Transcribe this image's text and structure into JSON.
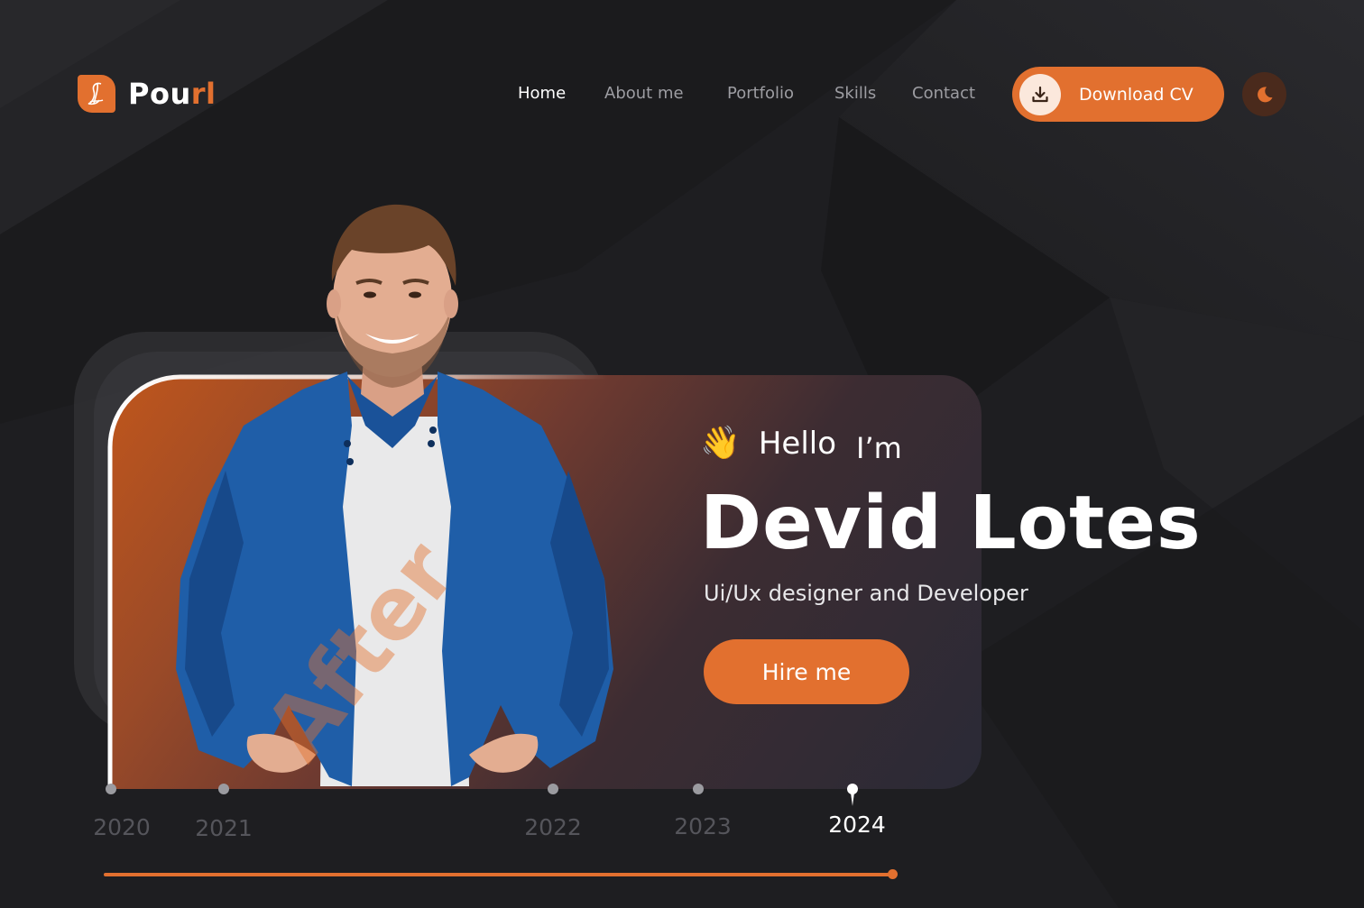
{
  "brand": {
    "logo_text_start": "Pou",
    "logo_text_accent": "rl",
    "accent_color": "#e2702f"
  },
  "nav": {
    "items": [
      {
        "label": "Home",
        "active": true
      },
      {
        "label": "About me",
        "active": false
      },
      {
        "label": "Portfolio",
        "active": false
      },
      {
        "label": "Skills",
        "active": false
      },
      {
        "label": "Contact",
        "active": false
      }
    ]
  },
  "header": {
    "download_label": "Download CV",
    "download_icon": "download-icon",
    "theme_icon": "moon-icon"
  },
  "hero": {
    "wave_emoji": "👋",
    "hello": "Hello",
    "im": "I’m",
    "name": "Devid Lotes",
    "role": "Ui/Ux designer and Developer",
    "hire_label": "Hire me",
    "watermark": "After"
  },
  "timeline": {
    "years": [
      {
        "label": "2020",
        "active": false
      },
      {
        "label": "2021",
        "active": false
      },
      {
        "label": "2022",
        "active": false
      },
      {
        "label": "2023",
        "active": false
      },
      {
        "label": "2024",
        "active": true
      }
    ],
    "progress": 1.0
  }
}
